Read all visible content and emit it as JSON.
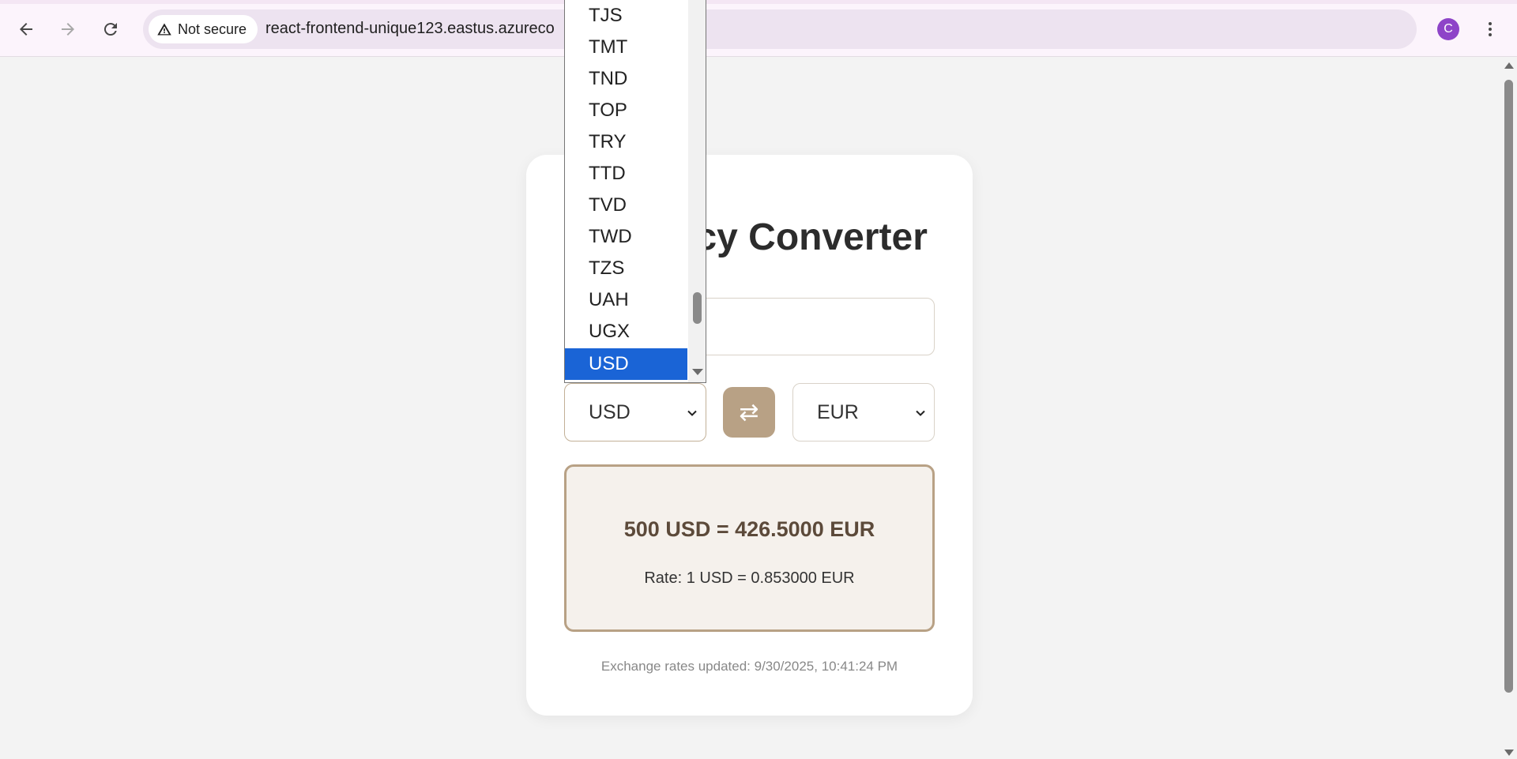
{
  "browser": {
    "security_label": "Not secure",
    "url": "react-frontend-unique123.eastus.azureco",
    "profile_initial": "C"
  },
  "app": {
    "title": "Currency Converter",
    "amount_value": "500",
    "from_currency": "USD",
    "to_currency": "EUR",
    "swap_symbol": "⇄",
    "result_main": "500 USD = 426.5000 EUR",
    "result_rate": "Rate: 1 USD = 0.853000 EUR",
    "updated_text": "Exchange rates updated: 9/30/2025, 10:41:24 PM",
    "accent_color": "#b8a185"
  },
  "dropdown": {
    "options": [
      "TJS",
      "TMT",
      "TND",
      "TOP",
      "TRY",
      "TTD",
      "TVD",
      "TWD",
      "TZS",
      "UAH",
      "UGX",
      "USD"
    ],
    "selected": "USD",
    "selected_color": "#1a64d6"
  }
}
